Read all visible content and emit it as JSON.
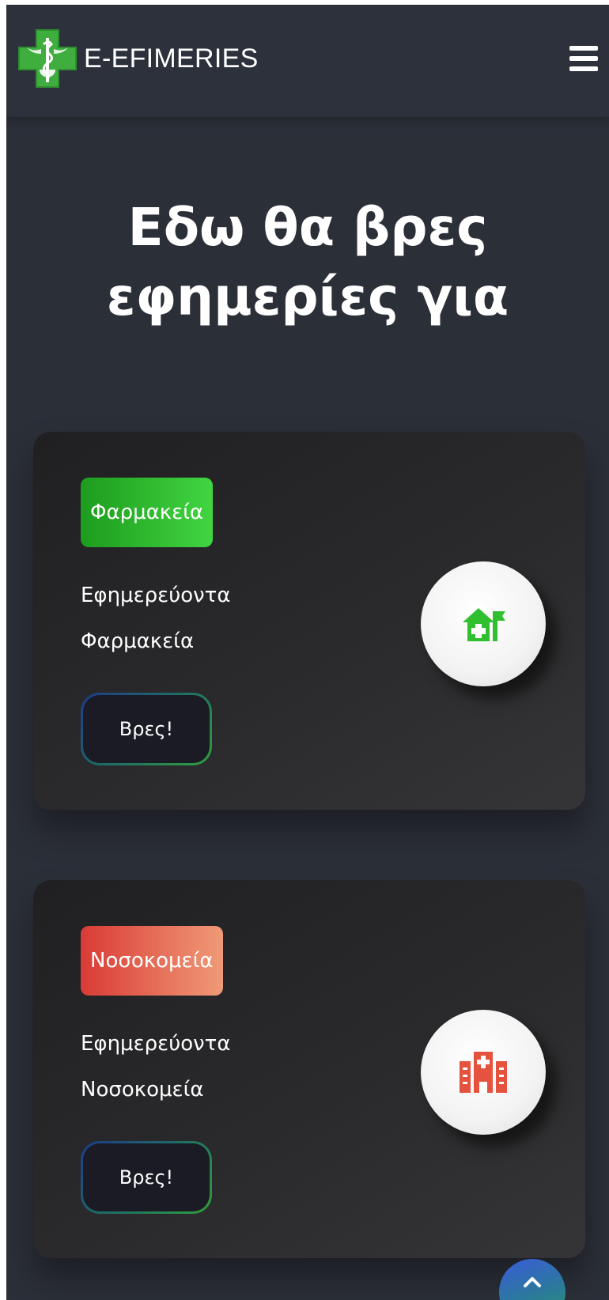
{
  "header": {
    "brand_name": "E-EFIMERIES",
    "logo_icon": "pharmacy-cross-caduceus-icon",
    "menu_icon": "hamburger-menu-icon"
  },
  "hero": {
    "title": "Εδω θα βρες\nεφημερίες για"
  },
  "cards": [
    {
      "badge": "Φαρμακεία",
      "description": "Εφημερεύοντα\nΦαρμακεία",
      "button": "Βρες!",
      "icon": "pharmacy-house-flag-icon",
      "accent": "#2fbf2f"
    },
    {
      "badge": "Νοσοκομεία",
      "description": "Εφημερεύοντα\nΝοσοκομεία",
      "button": "Βρες!",
      "icon": "hospital-building-icon",
      "accent": "#e5533f"
    }
  ],
  "scroll_top": {
    "icon": "chevron-up-icon"
  },
  "colors": {
    "page_bg": "#2b2f38",
    "card_bg": "#232325",
    "green": "#2fbf2f",
    "red": "#e5533f"
  }
}
